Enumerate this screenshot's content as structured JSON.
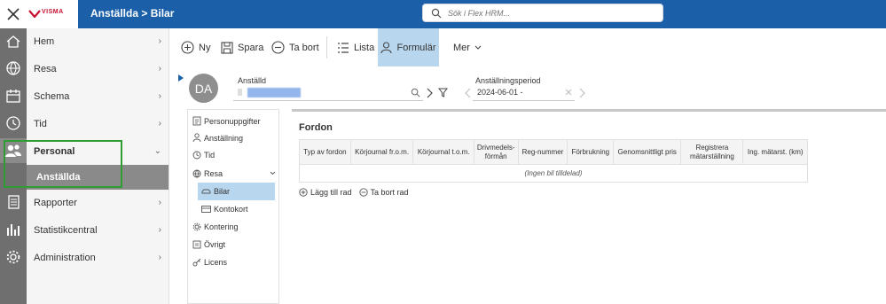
{
  "topbar": {
    "brand": "VISMA",
    "breadcrumb": "Anställda > Bilar",
    "search_placeholder": "Sök i Flex HRM..."
  },
  "sidebar": {
    "items": [
      {
        "label": "Hem"
      },
      {
        "label": "Resa"
      },
      {
        "label": "Schema"
      },
      {
        "label": "Tid"
      },
      {
        "label": "Personal"
      },
      {
        "label": "Rapporter"
      },
      {
        "label": "Statistikcentral"
      },
      {
        "label": "Administration"
      }
    ],
    "sub_item": "Anställda"
  },
  "toolbar": {
    "new_label": "Ny",
    "save_label": "Spara",
    "delete_label": "Ta bort",
    "list_label": "Lista",
    "form_label": "Formulär",
    "more_label": "Mer"
  },
  "employee": {
    "initials": "DA",
    "label": "Anställd",
    "period_label": "Anställningsperiod",
    "period_value": "2024-06-01 -"
  },
  "tree": {
    "items": [
      "Personuppgifter",
      "Anställning",
      "Tid",
      "Resa",
      "Bilar",
      "Kontokort",
      "Kontering",
      "Övrigt",
      "Licens"
    ]
  },
  "panel": {
    "title": "Fordon",
    "columns": [
      "Typ av fordon",
      "Körjournal fr.o.m.",
      "Körjournal t.o.m.",
      "Drivmedels-förmån",
      "Reg-nummer",
      "Förbrukning",
      "Genomsnittligt pris",
      "Registrera mätarställning",
      "Ing. mätarst. (km)"
    ],
    "empty_text": "(Ingen bil tilldelad)",
    "add_row": "Lägg till rad",
    "delete_row": "Ta bort rad"
  },
  "colors": {
    "topbar": "#1a5fa8",
    "highlight_green": "#2e9e34",
    "active_blue": "#b8d6ee"
  }
}
